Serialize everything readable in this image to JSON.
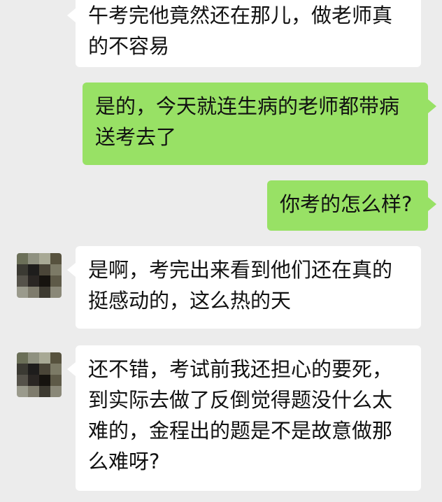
{
  "messages": [
    {
      "side": "in",
      "text": "午考完他竟然还在那儿，做老师真的不容易"
    },
    {
      "side": "out",
      "text": "是的，今天就连生病的老师都带病送考去了"
    },
    {
      "side": "out",
      "text": "你考的怎么样?"
    },
    {
      "side": "in",
      "text": "是啊，考完出来看到他们还在真的挺感动的，这么热的天"
    },
    {
      "side": "in",
      "text": "还不错，考试前我还担心的要死，到实际去做了反倒觉得题没什么太难的，金程出的题是不是故意做那么难呀?"
    }
  ],
  "colors": {
    "background": "#ececec",
    "incoming_bubble": "#ffffff",
    "outgoing_bubble": "#98e165"
  }
}
